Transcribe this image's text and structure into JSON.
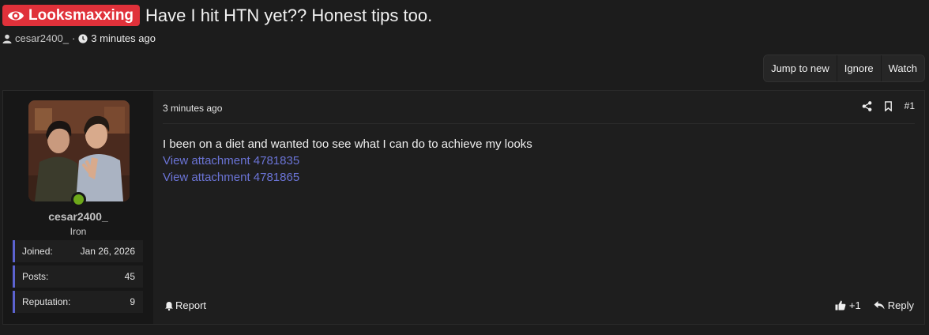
{
  "thread": {
    "prefix": "Looksmaxxing",
    "title": "Have I hit HTN yet?? Honest tips too.",
    "author": "cesar2400_",
    "time": "3 minutes ago"
  },
  "toolbar": {
    "jump_to_new": "Jump to new",
    "ignore": "Ignore",
    "watch": "Watch"
  },
  "post": {
    "time": "3 minutes ago",
    "number": "#1",
    "body_text": "I been on a diet and wanted too see what I can do to achieve my looks",
    "attachments": [
      "View attachment 4781835",
      "View attachment 4781865"
    ],
    "report_label": "Report",
    "reaction_count": "+1",
    "reply_label": "Reply"
  },
  "user": {
    "name": "cesar2400_",
    "title": "Iron",
    "online": true,
    "stats": [
      {
        "label": "Joined:",
        "value": "Jan 26, 2026"
      },
      {
        "label": "Posts:",
        "value": "45"
      },
      {
        "label": "Reputation:",
        "value": "9"
      }
    ]
  },
  "icons": {
    "prefix": "eye-icon",
    "author": "user-icon",
    "time": "clock-icon",
    "share": "share-icon",
    "bookmark": "bookmark-icon",
    "report": "bell-icon",
    "like": "thumbs-up-icon",
    "reply": "reply-icon"
  },
  "colors": {
    "prefix_bg": "#e0313a",
    "link": "#6b74d6",
    "stat_accent": "#5c63d0",
    "online": "#6da81a"
  }
}
